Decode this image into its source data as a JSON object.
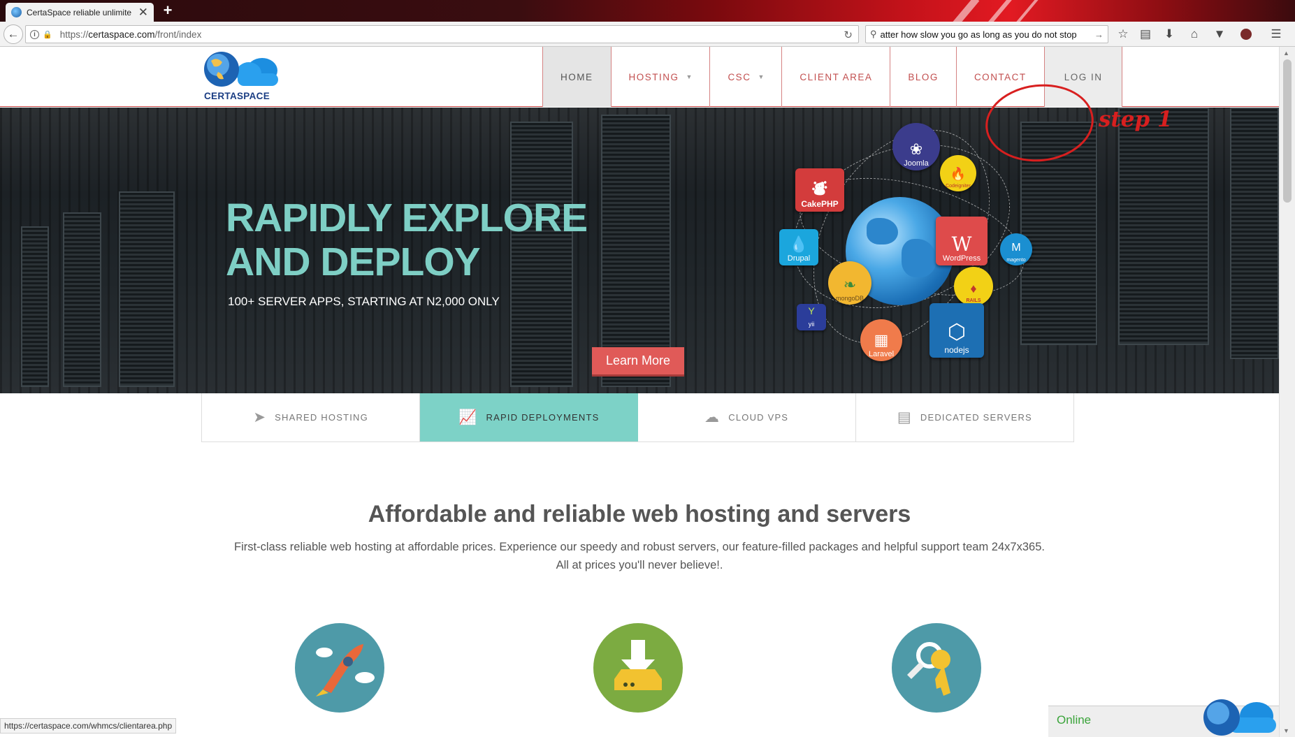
{
  "browser": {
    "tab_title": "CertaSpace reliable unlimite",
    "tab_close": "✕",
    "new_tab": "+",
    "url_prefix": "https://",
    "url_host": "certaspace.com",
    "url_path": "/front/index",
    "search_query": "atter how slow you go as long as you do not stop"
  },
  "site": {
    "logo_text": "CERTASPACE",
    "menu": [
      {
        "label": "HOME"
      },
      {
        "label": "HOSTING"
      },
      {
        "label": "CSC"
      },
      {
        "label": "CLIENT AREA"
      },
      {
        "label": "BLOG"
      },
      {
        "label": "CONTACT"
      },
      {
        "label": "LOG IN"
      }
    ],
    "annotation": "step 1",
    "hero": {
      "title_line1": "RAPIDLY EXPLORE",
      "title_line2": "AND DEPLOY",
      "subtitle": "100+ SERVER APPS, STARTING AT N2,000 ONLY",
      "button": "Learn More",
      "apps": [
        "Joomla",
        "Codeigniter",
        "CakePHP",
        "WordPress",
        "Drupal",
        "magento",
        "mongoDB",
        "RAILS",
        "yii",
        "Laravel",
        "nodejs"
      ]
    },
    "features": [
      {
        "label": "SHARED HOSTING",
        "icon": "rocket-icon"
      },
      {
        "label": "RAPID DEPLOYMENTS",
        "icon": "chart-icon"
      },
      {
        "label": "CLOUD VPS",
        "icon": "cloud-icon"
      },
      {
        "label": "DEDICATED SERVERS",
        "icon": "server-icon"
      }
    ],
    "intro": {
      "title": "Affordable and reliable web hosting and servers",
      "line1": "First-class reliable web hosting at affordable prices. Experience our speedy and robust servers, our feature-filled packages and helpful support team 24x7x365.",
      "line2": "All at prices you'll never believe!."
    },
    "status_url": "https://certaspace.com/whmcs/clientarea.php",
    "chat_status": "Online"
  }
}
